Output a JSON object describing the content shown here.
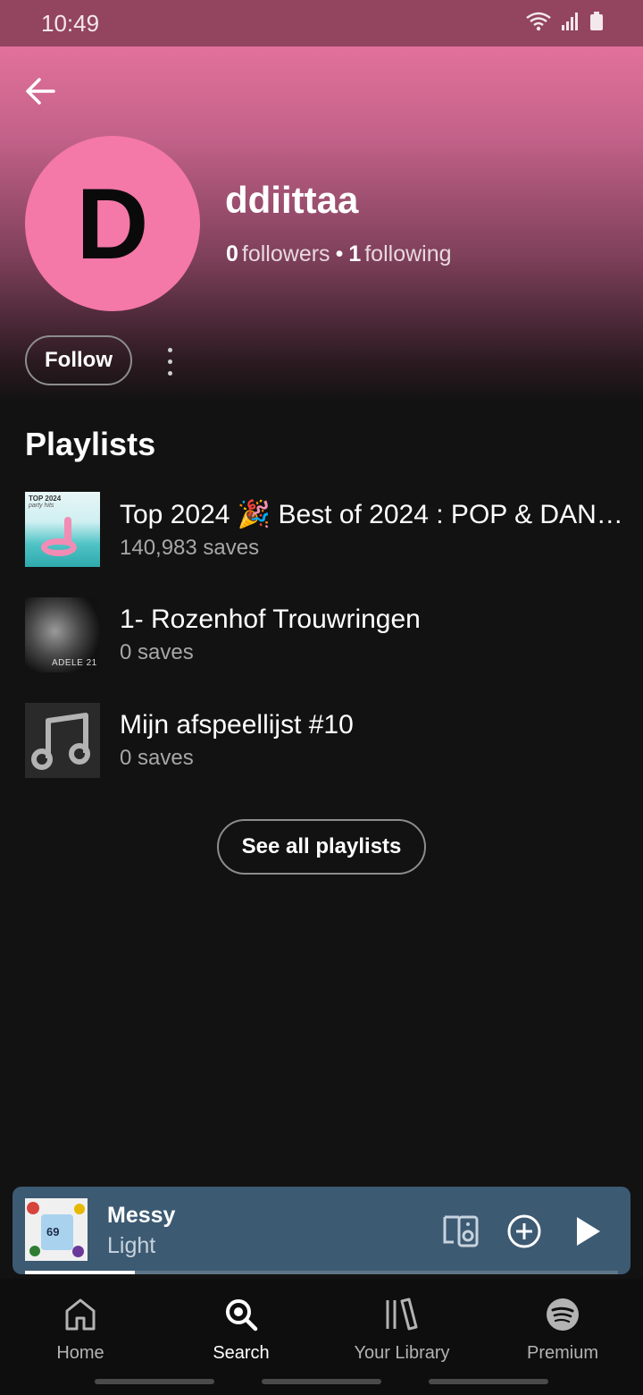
{
  "status": {
    "time": "10:49"
  },
  "profile": {
    "initial": "D",
    "name": "ddiittaa",
    "followers_count": "0",
    "followers_label": "followers",
    "separator": "•",
    "following_count": "1",
    "following_label": "following",
    "follow_label": "Follow"
  },
  "playlists": {
    "title": "Playlists",
    "items": [
      {
        "name": "Top 2024 🎉 Best of 2024 : POP & DAN…",
        "saves": "140,983 saves",
        "art_text": "TOP 2024",
        "art_subtext": "party hits"
      },
      {
        "name": "1- Rozenhof Trouwringen",
        "saves": "0 saves",
        "art_text": "ADELE 21"
      },
      {
        "name": "Mijn afspeellijst #10",
        "saves": "0 saves"
      }
    ],
    "see_all_label": "See all playlists"
  },
  "player": {
    "title": "Messy",
    "artist": "Light",
    "progress": 0.185,
    "art_text": "69"
  },
  "nav": {
    "home": "Home",
    "search": "Search",
    "library": "Your Library",
    "premium": "Premium",
    "active": "search"
  },
  "colors": {
    "accent_avatar": "#f478a8",
    "header_top": "#e2719a",
    "statusbar": "#93445f",
    "player_bg": "#3d5a73"
  }
}
